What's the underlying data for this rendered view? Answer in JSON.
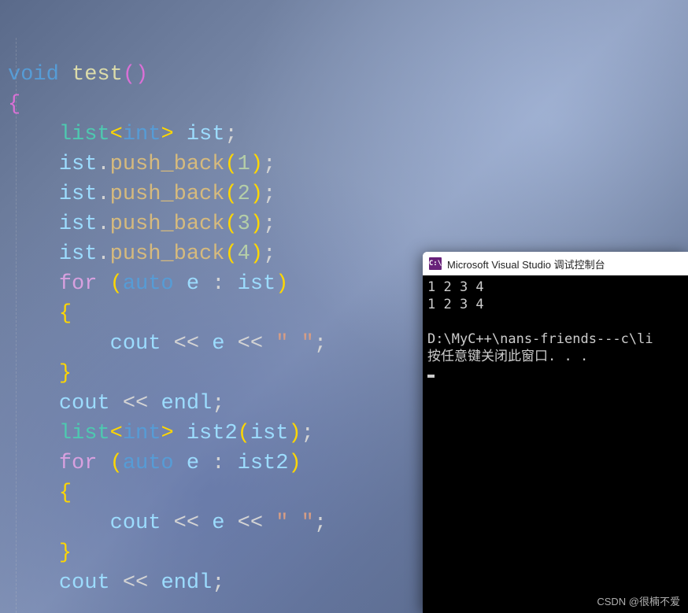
{
  "code": {
    "fn_signature": {
      "return_type": "void",
      "name": "test",
      "params": ""
    },
    "decl1": {
      "type": "list",
      "tparam": "int",
      "var": "ist"
    },
    "push_calls": [
      {
        "obj": "ist",
        "method": "push_back",
        "arg": "1"
      },
      {
        "obj": "ist",
        "method": "push_back",
        "arg": "2"
      },
      {
        "obj": "ist",
        "method": "push_back",
        "arg": "3"
      },
      {
        "obj": "ist",
        "method": "push_back",
        "arg": "4"
      }
    ],
    "for1": {
      "kw": "for",
      "auto": "auto",
      "var": "e",
      "in": "ist"
    },
    "body1": {
      "cout": "cout",
      "op": "<<",
      "e": "e",
      "str": "\" \""
    },
    "endl1": {
      "cout": "cout",
      "op": "<<",
      "endl": "endl"
    },
    "decl2": {
      "type": "list",
      "tparam": "int",
      "var": "ist2",
      "arg": "ist"
    },
    "for2": {
      "kw": "for",
      "auto": "auto",
      "var": "e",
      "in": "ist2"
    },
    "body2": {
      "cout": "cout",
      "op": "<<",
      "e": "e",
      "str": "\" \""
    },
    "endl2": {
      "cout": "cout",
      "op": "<<",
      "endl": "endl"
    }
  },
  "console": {
    "title": "Microsoft Visual Studio 调试控制台",
    "icon_label": "C:\\",
    "lines": [
      "1 2 3 4",
      "1 2 3 4",
      "",
      "D:\\MyC++\\nans-friends---c\\li",
      "按任意键关闭此窗口. . ."
    ]
  },
  "watermark": "CSDN @很楠不爱"
}
